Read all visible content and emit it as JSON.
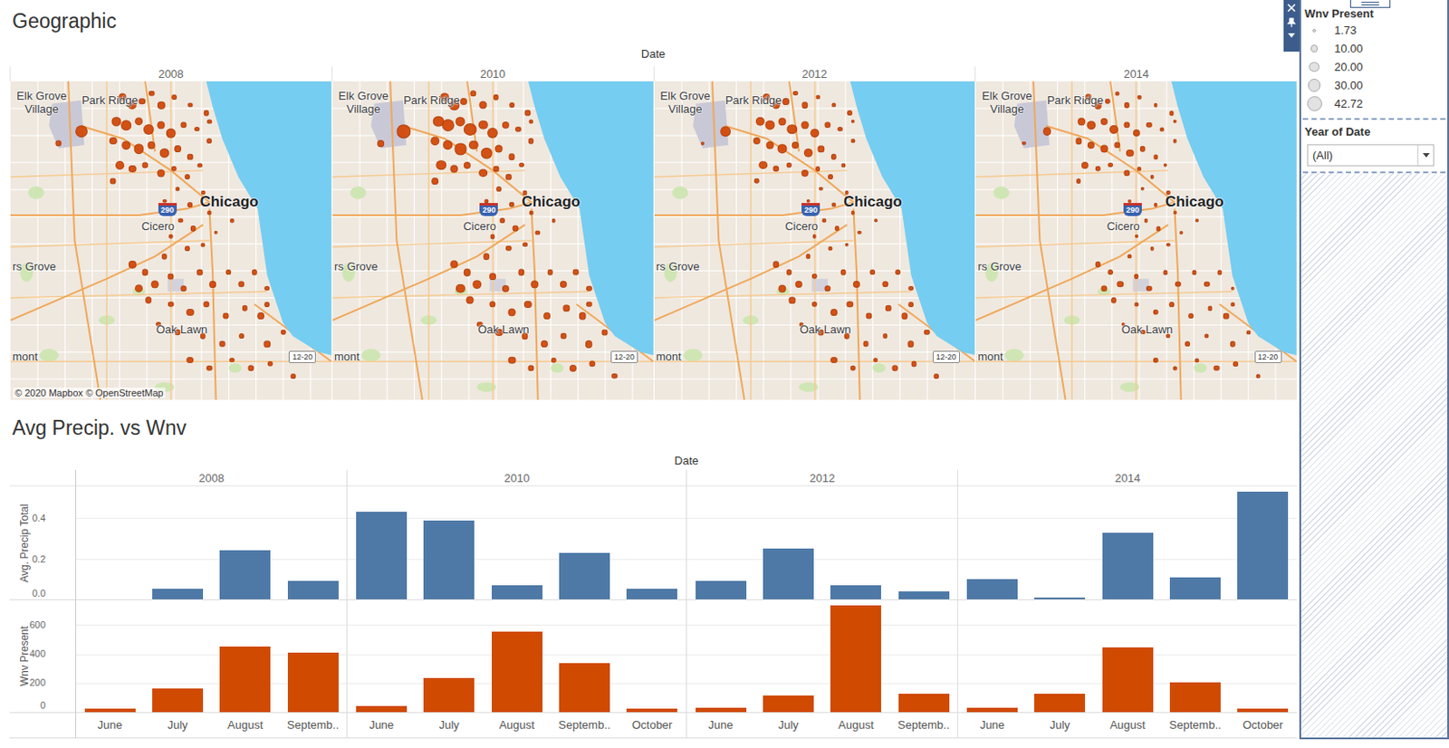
{
  "map_section": {
    "title": "Geographic",
    "column_header": "Date",
    "attribution": "© 2020 Mapbox © OpenStreetMap",
    "years": [
      "2008",
      "2010",
      "2012",
      "2014"
    ],
    "labels": [
      {
        "text": "Elk Grove Village",
        "kind": "town-wrap",
        "lon": -87.995,
        "lat": 42.04
      },
      {
        "text": "Park Ridge",
        "kind": "town",
        "lon": -87.889,
        "lat": 42.035
      },
      {
        "text": "Chicago",
        "kind": "city",
        "lon": -87.705,
        "lat": 41.909
      },
      {
        "text": "Cicero",
        "kind": "town",
        "lon": -87.796,
        "lat": 41.876
      },
      {
        "text": "290",
        "kind": "interstate",
        "lon": -87.77,
        "lat": 41.897
      },
      {
        "text": "rs Grove",
        "kind": "town",
        "lon": -87.997,
        "lat": 41.826
      },
      {
        "text": "Oak Lawn",
        "kind": "town",
        "lon": -87.773,
        "lat": 41.747
      },
      {
        "text": "mont",
        "kind": "town",
        "lon": -87.997,
        "lat": 41.713
      },
      {
        "text": "12-20",
        "kind": "route",
        "lon": -87.566,
        "lat": 41.712
      }
    ],
    "traps": [
      {
        "lon": -87.925,
        "lat": 41.972,
        "wnv": [
          8,
          9,
          2,
          3
        ]
      },
      {
        "lon": -87.889,
        "lat": 41.987,
        "wnv": [
          28,
          35,
          20,
          14
        ]
      },
      {
        "lon": -87.825,
        "lat": 42.03,
        "wnv": [
          12,
          14,
          10,
          8
        ]
      },
      {
        "lon": -87.81,
        "lat": 42.02,
        "wnv": [
          15,
          20,
          12,
          10
        ]
      },
      {
        "lon": -87.795,
        "lat": 42.025,
        "wnv": [
          8,
          10,
          9,
          6
        ]
      },
      {
        "lon": -87.78,
        "lat": 42.035,
        "wnv": [
          6,
          8,
          5,
          4
        ]
      },
      {
        "lon": -87.765,
        "lat": 42.02,
        "wnv": [
          10,
          12,
          8,
          6
        ]
      },
      {
        "lon": -87.745,
        "lat": 42.03,
        "wnv": [
          5,
          6,
          4,
          3
        ]
      },
      {
        "lon": -87.72,
        "lat": 42.02,
        "wnv": [
          4,
          5,
          4,
          3
        ]
      },
      {
        "lon": -87.835,
        "lat": 42.0,
        "wnv": [
          18,
          24,
          16,
          12
        ]
      },
      {
        "lon": -87.82,
        "lat": 41.995,
        "wnv": [
          20,
          28,
          18,
          14
        ]
      },
      {
        "lon": -87.8,
        "lat": 42.0,
        "wnv": [
          14,
          18,
          12,
          10
        ]
      },
      {
        "lon": -87.785,
        "lat": 41.99,
        "wnv": [
          22,
          30,
          20,
          15
        ]
      },
      {
        "lon": -87.765,
        "lat": 41.995,
        "wnv": [
          12,
          16,
          12,
          8
        ]
      },
      {
        "lon": -87.75,
        "lat": 41.985,
        "wnv": [
          16,
          22,
          14,
          10
        ]
      },
      {
        "lon": -87.73,
        "lat": 41.995,
        "wnv": [
          8,
          10,
          8,
          6
        ]
      },
      {
        "lon": -87.71,
        "lat": 41.99,
        "wnv": [
          5,
          6,
          5,
          4
        ]
      },
      {
        "lon": -87.84,
        "lat": 41.975,
        "wnv": [
          10,
          14,
          10,
          8
        ]
      },
      {
        "lon": -87.82,
        "lat": 41.97,
        "wnv": [
          14,
          20,
          12,
          10
        ]
      },
      {
        "lon": -87.8,
        "lat": 41.965,
        "wnv": [
          20,
          26,
          18,
          12
        ]
      },
      {
        "lon": -87.78,
        "lat": 41.97,
        "wnv": [
          12,
          16,
          10,
          8
        ]
      },
      {
        "lon": -87.76,
        "lat": 41.96,
        "wnv": [
          18,
          24,
          16,
          10
        ]
      },
      {
        "lon": -87.74,
        "lat": 41.965,
        "wnv": [
          9,
          12,
          8,
          6
        ]
      },
      {
        "lon": -87.72,
        "lat": 41.955,
        "wnv": [
          6,
          8,
          6,
          4
        ]
      },
      {
        "lon": -87.83,
        "lat": 41.945,
        "wnv": [
          15,
          20,
          14,
          10
        ]
      },
      {
        "lon": -87.81,
        "lat": 41.94,
        "wnv": [
          10,
          12,
          8,
          6
        ]
      },
      {
        "lon": -87.79,
        "lat": 41.945,
        "wnv": [
          8,
          10,
          6,
          5
        ]
      },
      {
        "lon": -87.765,
        "lat": 41.935,
        "wnv": [
          12,
          14,
          10,
          8
        ]
      },
      {
        "lon": -87.745,
        "lat": 41.94,
        "wnv": [
          6,
          7,
          5,
          4
        ]
      },
      {
        "lon": -87.725,
        "lat": 41.93,
        "wnv": [
          5,
          6,
          5,
          3
        ]
      },
      {
        "lon": -87.705,
        "lat": 41.945,
        "wnv": [
          4,
          5,
          4,
          3
        ]
      },
      {
        "lon": -87.69,
        "lat": 41.975,
        "wnv": [
          5,
          6,
          4,
          3
        ]
      },
      {
        "lon": -87.695,
        "lat": 42.01,
        "wnv": [
          6,
          7,
          5,
          4
        ]
      },
      {
        "lon": -87.84,
        "lat": 41.925,
        "wnv": [
          7,
          9,
          6,
          5
        ]
      },
      {
        "lon": -87.69,
        "lat": 42.0,
        "wnv": [
          4,
          4,
          3,
          3
        ]
      },
      {
        "lon": -87.74,
        "lat": 41.915,
        "wnv": [
          4,
          5,
          3,
          3
        ]
      },
      {
        "lon": -87.76,
        "lat": 41.9,
        "wnv": [
          3,
          4,
          3,
          2
        ]
      },
      {
        "lon": -87.72,
        "lat": 41.895,
        "wnv": [
          5,
          6,
          4,
          3
        ]
      },
      {
        "lon": -87.7,
        "lat": 41.91,
        "wnv": [
          3,
          4,
          3,
          3
        ]
      },
      {
        "lon": -87.735,
        "lat": 41.875,
        "wnv": [
          4,
          5,
          4,
          3
        ]
      },
      {
        "lon": -87.715,
        "lat": 41.865,
        "wnv": [
          6,
          7,
          5,
          4
        ]
      },
      {
        "lon": -87.75,
        "lat": 41.855,
        "wnv": [
          3,
          4,
          3,
          2
        ]
      },
      {
        "lon": -87.69,
        "lat": 41.885,
        "wnv": [
          3,
          3,
          3,
          2
        ]
      },
      {
        "lon": -87.725,
        "lat": 41.84,
        "wnv": [
          5,
          6,
          4,
          3
        ]
      },
      {
        "lon": -87.7,
        "lat": 41.845,
        "wnv": [
          4,
          5,
          3,
          3
        ]
      },
      {
        "lon": -87.68,
        "lat": 41.86,
        "wnv": [
          3,
          4,
          3,
          2
        ]
      },
      {
        "lon": -87.76,
        "lat": 41.83,
        "wnv": [
          6,
          8,
          5,
          4
        ]
      },
      {
        "lon": -87.655,
        "lat": 41.875,
        "wnv": [
          3,
          3,
          2,
          2
        ]
      },
      {
        "lon": -87.81,
        "lat": 41.82,
        "wnv": [
          10,
          12,
          8,
          6
        ]
      },
      {
        "lon": -87.79,
        "lat": 41.81,
        "wnv": [
          8,
          10,
          6,
          5
        ]
      },
      {
        "lon": -87.775,
        "lat": 41.795,
        "wnv": [
          12,
          14,
          10,
          8
        ]
      },
      {
        "lon": -87.8,
        "lat": 41.79,
        "wnv": [
          14,
          16,
          12,
          8
        ]
      },
      {
        "lon": -87.785,
        "lat": 41.775,
        "wnv": [
          9,
          12,
          8,
          6
        ]
      },
      {
        "lon": -87.75,
        "lat": 41.805,
        "wnv": [
          7,
          9,
          6,
          5
        ]
      },
      {
        "lon": -87.73,
        "lat": 41.79,
        "wnv": [
          8,
          10,
          8,
          6
        ]
      },
      {
        "lon": -87.705,
        "lat": 41.81,
        "wnv": [
          6,
          8,
          6,
          4
        ]
      },
      {
        "lon": -87.685,
        "lat": 41.795,
        "wnv": [
          9,
          12,
          10,
          6
        ]
      },
      {
        "lon": -87.66,
        "lat": 41.81,
        "wnv": [
          5,
          6,
          5,
          4
        ]
      },
      {
        "lon": -87.64,
        "lat": 41.795,
        "wnv": [
          8,
          10,
          8,
          6
        ]
      },
      {
        "lon": -87.62,
        "lat": 41.81,
        "wnv": [
          6,
          7,
          5,
          4
        ]
      },
      {
        "lon": -87.6,
        "lat": 41.79,
        "wnv": [
          5,
          6,
          5,
          3
        ]
      },
      {
        "lon": -87.75,
        "lat": 41.77,
        "wnv": [
          6,
          8,
          6,
          4
        ]
      },
      {
        "lon": -87.72,
        "lat": 41.76,
        "wnv": [
          10,
          12,
          9,
          6
        ]
      },
      {
        "lon": -87.695,
        "lat": 41.77,
        "wnv": [
          8,
          10,
          8,
          5
        ]
      },
      {
        "lon": -87.665,
        "lat": 41.755,
        "wnv": [
          7,
          9,
          7,
          5
        ]
      },
      {
        "lon": -87.635,
        "lat": 41.765,
        "wnv": [
          6,
          8,
          6,
          4
        ]
      },
      {
        "lon": -87.61,
        "lat": 41.755,
        "wnv": [
          9,
          11,
          8,
          6
        ]
      },
      {
        "lon": -87.6,
        "lat": 41.77,
        "wnv": [
          5,
          6,
          5,
          4
        ]
      },
      {
        "lon": -87.77,
        "lat": 41.745,
        "wnv": [
          5,
          6,
          4,
          3
        ]
      },
      {
        "lon": -87.74,
        "lat": 41.735,
        "wnv": [
          8,
          10,
          7,
          5
        ]
      },
      {
        "lon": -87.7,
        "lat": 41.73,
        "wnv": [
          6,
          8,
          6,
          4
        ]
      },
      {
        "lon": -87.67,
        "lat": 41.72,
        "wnv": [
          7,
          9,
          7,
          5
        ]
      },
      {
        "lon": -87.64,
        "lat": 41.73,
        "wnv": [
          5,
          7,
          5,
          4
        ]
      },
      {
        "lon": -87.6,
        "lat": 41.72,
        "wnv": [
          8,
          10,
          8,
          6
        ]
      },
      {
        "lon": -87.575,
        "lat": 41.735,
        "wnv": [
          6,
          7,
          6,
          4
        ]
      },
      {
        "lon": -87.72,
        "lat": 41.7,
        "wnv": [
          9,
          11,
          9,
          6
        ]
      },
      {
        "lon": -87.69,
        "lat": 41.69,
        "wnv": [
          6,
          8,
          6,
          4
        ]
      },
      {
        "lon": -87.655,
        "lat": 41.7,
        "wnv": [
          5,
          6,
          5,
          4
        ]
      },
      {
        "lon": -87.625,
        "lat": 41.69,
        "wnv": [
          8,
          10,
          8,
          6
        ]
      },
      {
        "lon": -87.595,
        "lat": 41.695,
        "wnv": [
          6,
          8,
          7,
          5
        ]
      },
      {
        "lon": -87.56,
        "lat": 41.68,
        "wnv": [
          5,
          6,
          5,
          4
        ]
      },
      {
        "lon": -87.535,
        "lat": 41.7,
        "wnv": [
          4,
          5,
          4,
          3
        ]
      }
    ]
  },
  "chart_section": {
    "title": "Avg Precip. vs Wnv",
    "column_header": "Date",
    "series": [
      {
        "label": "Avg. Precip Total",
        "color": "#4e79a7",
        "ticks": [
          {
            "label": "0.4",
            "value": 0.4
          },
          {
            "label": "0.2",
            "value": 0.2
          },
          {
            "label": "0.0",
            "value": 0
          }
        ]
      },
      {
        "label": "Wnv Present",
        "color": "#d04a02",
        "ticks": [
          {
            "label": "600",
            "value": 600
          },
          {
            "label": "400",
            "value": 400
          },
          {
            "label": "200",
            "value": 200
          },
          {
            "label": "0",
            "value": 0
          }
        ]
      }
    ],
    "years": [
      {
        "year": "2008",
        "months": [
          "June",
          "July",
          "August",
          "Septemb.."
        ],
        "values": [
          [
            0,
            0.05,
            0.24,
            0.09
          ],
          [
            25,
            165,
            450,
            410
          ]
        ]
      },
      {
        "year": "2010",
        "months": [
          "June",
          "July",
          "August",
          "Septemb..",
          "October"
        ],
        "values": [
          [
            0.43,
            0.39,
            0.07,
            0.23,
            0.05
          ],
          [
            45,
            235,
            555,
            340,
            25
          ]
        ]
      },
      {
        "year": "2012",
        "months": [
          "June",
          "July",
          "August",
          "Septemb.."
        ],
        "values": [
          [
            0.09,
            0.25,
            0.07,
            0.04
          ],
          [
            30,
            115,
            735,
            125
          ]
        ]
      },
      {
        "year": "2014",
        "months": [
          "June",
          "July",
          "August",
          "Septemb..",
          "October"
        ],
        "values": [
          [
            0.1,
            0.01,
            0.33,
            0.11,
            0.53
          ],
          [
            30,
            125,
            445,
            205,
            25
          ]
        ]
      }
    ]
  },
  "legend": {
    "title": "Wnv Present",
    "sizes": [
      "1.73",
      "10.00",
      "20.00",
      "30.00",
      "42.72"
    ]
  },
  "filter": {
    "title": "Year of Date",
    "value": "(All)"
  }
}
